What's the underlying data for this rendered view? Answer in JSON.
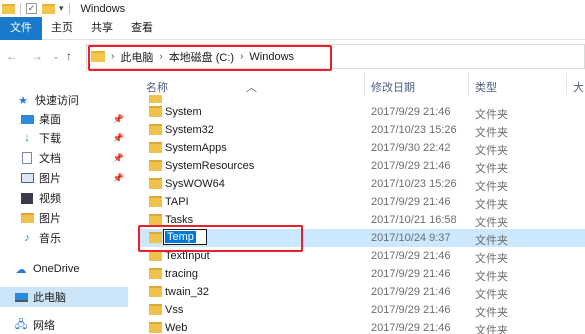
{
  "window": {
    "title": "Windows"
  },
  "ribbon": {
    "tabs": [
      "文件",
      "主页",
      "共享",
      "查看"
    ]
  },
  "address": {
    "crumbs": [
      "此电脑",
      "本地磁盘 (C:)",
      "Windows"
    ]
  },
  "sidebar": {
    "items": [
      {
        "label": "快速访问",
        "icon": "star-icon"
      },
      {
        "label": "桌面",
        "icon": "desktop-icon"
      },
      {
        "label": "下载",
        "icon": "download-icon"
      },
      {
        "label": "文档",
        "icon": "document-icon"
      },
      {
        "label": "图片",
        "icon": "pictures-icon"
      },
      {
        "label": "视频",
        "icon": "video-icon"
      },
      {
        "label": "图片",
        "icon": "folder-icon"
      },
      {
        "label": "音乐",
        "icon": "music-icon"
      },
      {
        "label": "OneDrive",
        "icon": "cloud-icon"
      },
      {
        "label": "此电脑",
        "icon": "computer-icon"
      },
      {
        "label": "网络",
        "icon": "network-icon"
      }
    ]
  },
  "columns": {
    "name": "名称",
    "date": "修改日期",
    "type": "类型",
    "size": "大"
  },
  "files": [
    {
      "name": "System",
      "date": "2017/9/29 21:46",
      "type": "文件夹"
    },
    {
      "name": "System32",
      "date": "2017/10/23 15:26",
      "type": "文件夹"
    },
    {
      "name": "SystemApps",
      "date": "2017/9/30 22:42",
      "type": "文件夹"
    },
    {
      "name": "SystemResources",
      "date": "2017/9/29 21:46",
      "type": "文件夹"
    },
    {
      "name": "SysWOW64",
      "date": "2017/10/23 15:26",
      "type": "文件夹"
    },
    {
      "name": "TAPI",
      "date": "2017/9/29 21:46",
      "type": "文件夹"
    },
    {
      "name": "Tasks",
      "date": "2017/10/21 16:58",
      "type": "文件夹"
    },
    {
      "name": "Temp",
      "date": "2017/10/24 9:37",
      "type": "文件夹"
    },
    {
      "name": "TextInput",
      "date": "2017/9/29 21:46",
      "type": "文件夹"
    },
    {
      "name": "tracing",
      "date": "2017/9/29 21:46",
      "type": "文件夹"
    },
    {
      "name": "twain_32",
      "date": "2017/9/29 21:46",
      "type": "文件夹"
    },
    {
      "name": "Vss",
      "date": "2017/9/29 21:46",
      "type": "文件夹"
    },
    {
      "name": "Web",
      "date": "2017/9/29 21:46",
      "type": "文件夹"
    }
  ],
  "rename": {
    "value": "Temp"
  },
  "colors": {
    "accent": "#1979ca",
    "highlight": "#e8202a",
    "selection": "#cce8ff"
  }
}
